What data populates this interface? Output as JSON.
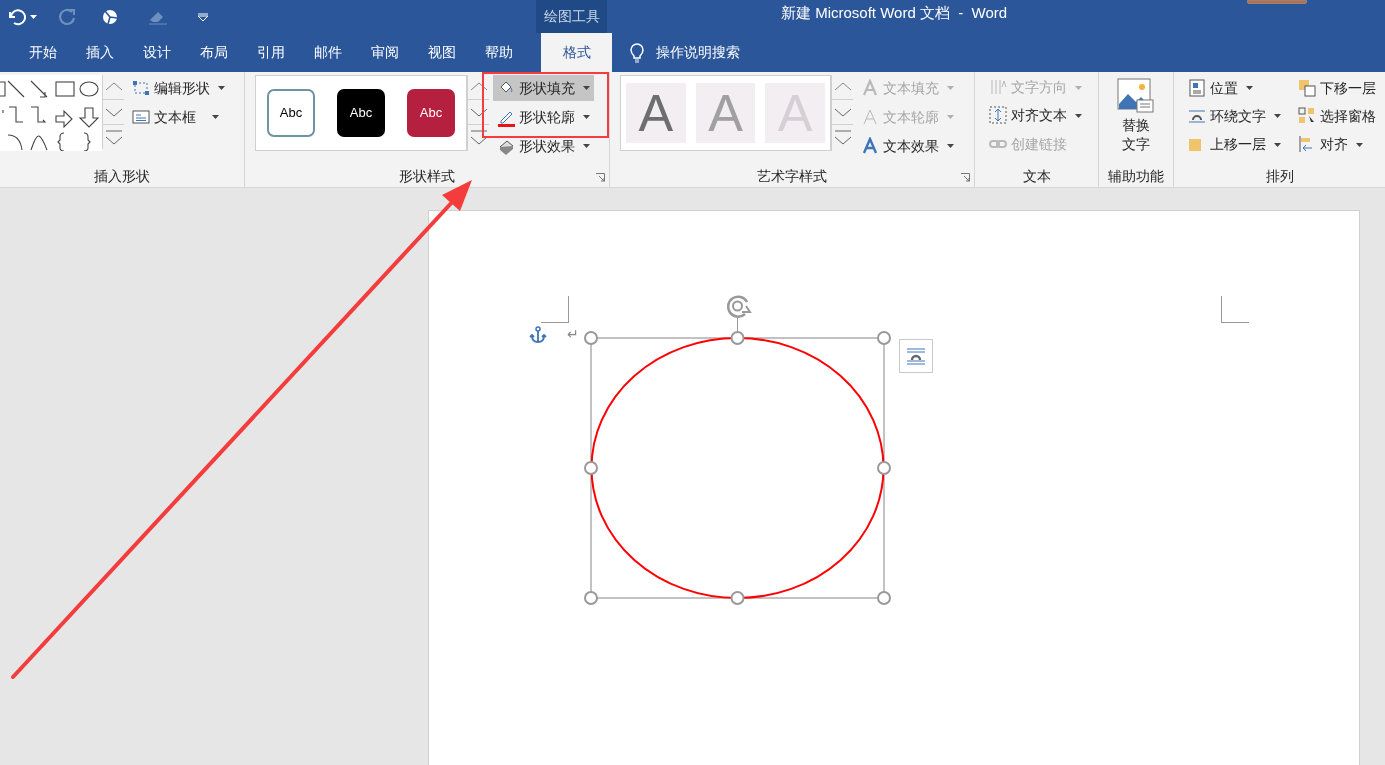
{
  "window": {
    "title": "新建 Microsoft Word 文档  -  Word",
    "contextual_tab": "绘图工具"
  },
  "tabs": [
    {
      "label": "开始",
      "selected": false
    },
    {
      "label": "插入",
      "selected": false
    },
    {
      "label": "设计",
      "selected": false
    },
    {
      "label": "布局",
      "selected": false
    },
    {
      "label": "引用",
      "selected": false
    },
    {
      "label": "邮件",
      "selected": false
    },
    {
      "label": "审阅",
      "selected": false
    },
    {
      "label": "视图",
      "selected": false
    },
    {
      "label": "帮助",
      "selected": false
    },
    {
      "label": "格式",
      "selected": true
    }
  ],
  "tell_me": "操作说明搜索",
  "groups": [
    {
      "kind": "shapes",
      "label": "插入形状",
      "commands": [
        {
          "kind": "editshape",
          "label": "编辑形状",
          "dropdown": true,
          "disabled": false,
          "hovered": false
        },
        {
          "kind": "textbox",
          "label": "文本框",
          "dropdown": true,
          "disabled": false,
          "hovered": false
        }
      ]
    },
    {
      "kind": "styles",
      "label": "形状样式",
      "launcher": true,
      "gallery": [
        {
          "text": "Abc",
          "color": "#ffffff"
        },
        {
          "text": "Abc",
          "color": "#000000"
        },
        {
          "text": "Abc",
          "color": "#b51f40"
        }
      ],
      "commands": [
        {
          "kind": "fill",
          "label": "形状填充",
          "dropdown": true,
          "disabled": false,
          "hovered": true
        },
        {
          "kind": "outline",
          "label": "形状轮廓",
          "dropdown": true,
          "disabled": false,
          "hovered": false
        },
        {
          "kind": "effect",
          "label": "形状效果",
          "dropdown": true,
          "disabled": false,
          "hovered": false
        }
      ]
    },
    {
      "kind": "wordart",
      "label": "艺术字样式",
      "launcher": true,
      "gallery": [
        {
          "text": "A",
          "color": "#6e6e6e"
        },
        {
          "text": "A",
          "color": "#a0a0a0"
        },
        {
          "text": "A",
          "color": "#d6d0d6"
        }
      ],
      "commands": [
        {
          "kind": "textfill",
          "label": "文本填充",
          "dropdown": true,
          "disabled": true,
          "hovered": false
        },
        {
          "kind": "textoutline",
          "label": "文本轮廓",
          "dropdown": true,
          "disabled": true,
          "hovered": false
        },
        {
          "kind": "texteffect",
          "label": "文本效果",
          "dropdown": true,
          "disabled": false,
          "hovered": false
        }
      ]
    },
    {
      "kind": "text",
      "label": "文本",
      "commands": [
        {
          "kind": "direction",
          "label": "文字方向",
          "dropdown": true,
          "disabled": true,
          "hovered": false
        },
        {
          "kind": "align",
          "label": "对齐文本",
          "dropdown": true,
          "disabled": false,
          "hovered": false
        },
        {
          "kind": "link",
          "label": "创建链接",
          "dropdown": false,
          "disabled": true,
          "hovered": false
        }
      ]
    },
    {
      "kind": "large",
      "label": "辅助功能",
      "commands": [
        {
          "kind": "alttext",
          "label": "替换文字",
          "dropdown": false,
          "disabled": false,
          "hovered": false
        }
      ]
    },
    {
      "kind": "arrange",
      "label": "排列",
      "commands": [
        {
          "kind": "position",
          "label": "位置",
          "dropdown": true,
          "disabled": false,
          "hovered": false
        },
        {
          "kind": "wrap",
          "label": "环绕文字",
          "dropdown": true,
          "disabled": false,
          "hovered": false
        },
        {
          "kind": "forward",
          "label": "上移一层",
          "dropdown": true,
          "disabled": false,
          "hovered": false
        },
        {
          "kind": "backward",
          "label": "下移一层",
          "dropdown": false,
          "disabled": false,
          "hovered": false
        },
        {
          "kind": "pane",
          "label": "选择窗格",
          "dropdown": false,
          "disabled": false,
          "hovered": false
        },
        {
          "kind": "alignobj",
          "label": "对齐",
          "dropdown": true,
          "disabled": false,
          "hovered": false
        }
      ]
    }
  ],
  "document": {
    "paragraph_mark": "↵"
  }
}
